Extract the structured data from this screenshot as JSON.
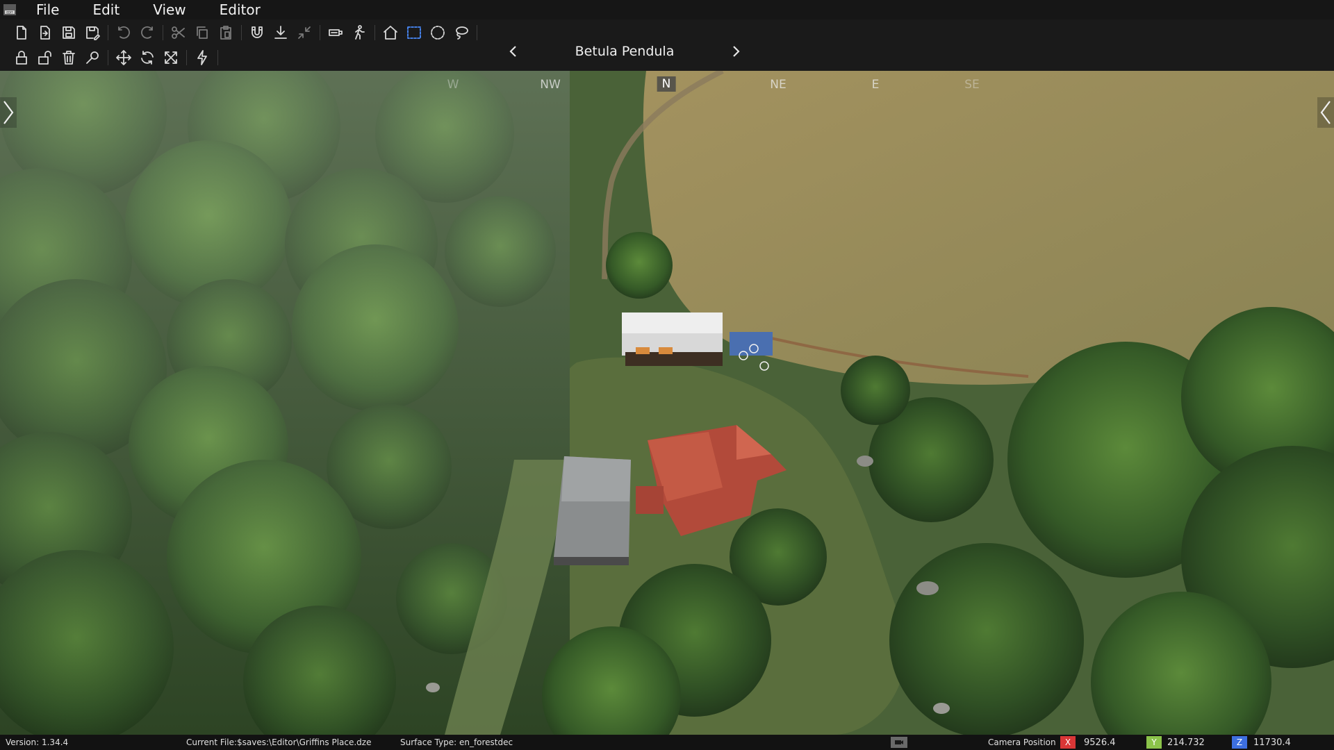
{
  "menubar": {
    "logo_icon": "editor-logo-icon",
    "items": [
      "File",
      "Edit",
      "View",
      "Editor"
    ]
  },
  "toolbar": {
    "row1": [
      "new-file-icon",
      "open-file-icon",
      "save-icon",
      "save-as-icon",
      "undo-icon",
      "redo-icon",
      "cut-icon",
      "copy-icon",
      "paste-icon",
      "magnet-snap-icon",
      "ground-snap-icon",
      "collapse-icon",
      "camera-icon",
      "walk-icon",
      "home-icon",
      "rectangle-select-icon",
      "circle-select-icon",
      "lasso-select-icon"
    ],
    "row2": [
      "lock-icon",
      "unlock-icon",
      "delete-icon",
      "search-icon",
      "move-icon",
      "rotate-icon",
      "scale-icon",
      "lightning-icon"
    ],
    "object_name": "Betula Pendula",
    "accent_color": "#4a8cff"
  },
  "compass": {
    "labels": [
      "W",
      "NW",
      "N",
      "NE",
      "E",
      "SE"
    ],
    "active": "N"
  },
  "statusbar": {
    "version": "Version:  1.34.4",
    "current_file": "Current File:$saves:\\Editor\\Griffins Place.dze",
    "surface_type": "Surface Type: en_forestdec",
    "camera_label": "Camera Position",
    "x_label": "X",
    "x_value": "9526.4",
    "x_color": "#d93636",
    "y_label": "Y",
    "y_value": "214.732",
    "y_color": "#8bc34a",
    "z_label": "Z",
    "z_value": "11730.4",
    "z_color": "#3d6fe0"
  }
}
